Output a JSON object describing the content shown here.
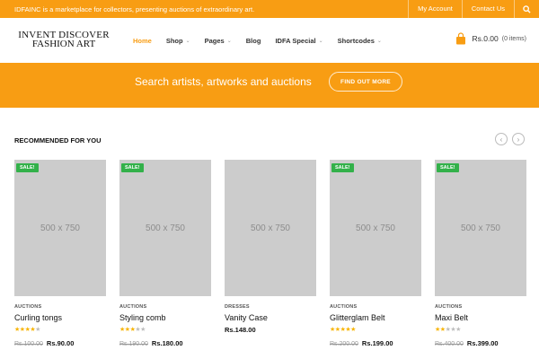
{
  "topbar": {
    "message": "IDFAINC is a marketplace for collectors, presenting auctions of extraordinary art.",
    "links": [
      "My Account",
      "Contact Us"
    ],
    "color": "#f89d13"
  },
  "header": {
    "logo_line1": "INVENT DISCOVER",
    "logo_line2": "FASHION ART",
    "nav": [
      {
        "label": "Home",
        "active": true,
        "dropdown": false
      },
      {
        "label": "Shop",
        "active": false,
        "dropdown": true
      },
      {
        "label": "Pages",
        "active": false,
        "dropdown": true
      },
      {
        "label": "Blog",
        "active": false,
        "dropdown": false
      },
      {
        "label": "IDFA Special",
        "active": false,
        "dropdown": true
      },
      {
        "label": "Shortcodes",
        "active": false,
        "dropdown": true
      }
    ],
    "cart_total": "Rs.0.00",
    "cart_items": "(0 items)"
  },
  "banner": {
    "text": "Search artists, artworks and auctions",
    "button": "FIND OUT MORE"
  },
  "section": {
    "title": "RECOMMENDED FOR YOU"
  },
  "products": [
    {
      "placeholder": "500 x 750",
      "sale": "SALE!",
      "category": "AUCTIONS",
      "name": "Curling tongs",
      "rating": 4,
      "old_price": "Rs.100.00",
      "price": "Rs.90.00"
    },
    {
      "placeholder": "500 x 750",
      "sale": "SALE!",
      "category": "AUCTIONS",
      "name": "Styling comb",
      "rating": 3,
      "old_price": "Rs.190.00",
      "price": "Rs.180.00"
    },
    {
      "placeholder": "500 x 750",
      "sale": "",
      "category": "DRESSES",
      "name": "Vanity Case",
      "rating": 0,
      "old_price": "",
      "price": "Rs.148.00"
    },
    {
      "placeholder": "500 x 750",
      "sale": "SALE!",
      "category": "AUCTIONS",
      "name": "Glitterglam Belt",
      "rating": 5,
      "old_price": "Rs.200.00",
      "price": "Rs.199.00"
    },
    {
      "placeholder": "500 x 750",
      "sale": "SALE!",
      "category": "AUCTIONS",
      "name": "Maxi Belt",
      "rating": 2,
      "old_price": "Rs.400.00",
      "price": "Rs.399.00"
    }
  ]
}
